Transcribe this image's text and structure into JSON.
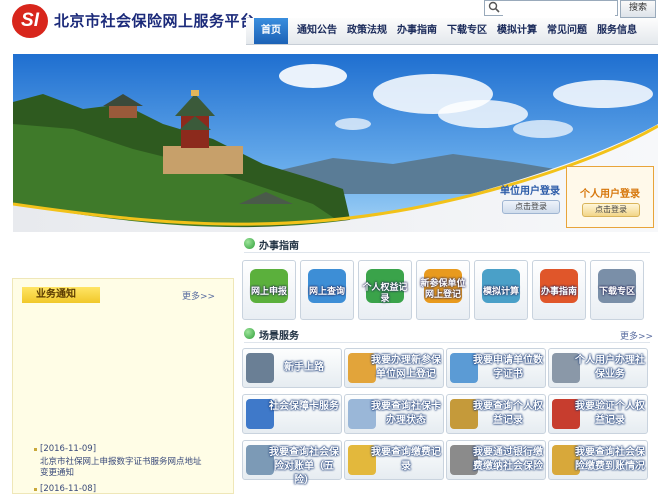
{
  "header": {
    "logo_text": "SI",
    "title": "北京市社会保险网上服务平台",
    "search": {
      "placeholder": "",
      "button_label": "搜索"
    }
  },
  "nav": {
    "items": [
      {
        "label": "首页",
        "active": true
      },
      {
        "label": "通知公告"
      },
      {
        "label": "政策法规"
      },
      {
        "label": "办事指南"
      },
      {
        "label": "下载专区"
      },
      {
        "label": "模拟计算"
      },
      {
        "label": "常见问题"
      },
      {
        "label": "服务信息"
      }
    ]
  },
  "login": {
    "unit": {
      "title": "单位用户登录",
      "button": "点击登录"
    },
    "personal": {
      "title": "个人用户登录",
      "button": "点击登录"
    }
  },
  "notices": {
    "tab_label": "业务通知",
    "more": "更多>>",
    "items": [
      {
        "date": "[2016-11-09]",
        "text_line1": "北京市社保网上申报数字证书服务网点地址",
        "text_line2": "变更通知"
      },
      {
        "date": "[2016-11-08]",
        "text_line1": "",
        "text_line2": ""
      }
    ]
  },
  "guide": {
    "title": "办事指南",
    "items": [
      {
        "label": "网上申报",
        "color": "#5bb03c"
      },
      {
        "label": "网上查询",
        "color": "#3d8ed6"
      },
      {
        "label": "个人权益记录",
        "color": "#3aa34a"
      },
      {
        "label": "新参保单位网上登记",
        "color": "#e89a1e"
      },
      {
        "label": "模拟计算",
        "color": "#4aa0c8"
      },
      {
        "label": "办事指南",
        "color": "#e0562a"
      },
      {
        "label": "下载专区",
        "color": "#7a8fa8"
      }
    ]
  },
  "scenes": {
    "title": "场景服务",
    "more": "更多>>",
    "items": [
      {
        "label": "新手上路",
        "color": "#6a7f95"
      },
      {
        "label": "我要办理新参保单位网上登记",
        "color": "#e2a43a"
      },
      {
        "label": "我要申请单位数字证书",
        "color": "#5b9bd5"
      },
      {
        "label": "个人用户办理社保业务",
        "color": "#8a98a8"
      },
      {
        "label": "社会保障卡服务",
        "color": "#3f79c9"
      },
      {
        "label": "我要查询社保卡办理状态",
        "color": "#9ab7d8"
      },
      {
        "label": "我要查询个人权益记录",
        "color": "#c59a3a"
      },
      {
        "label": "我要验证个人权益记录",
        "color": "#c73d2e"
      },
      {
        "label": "我要查询社会保险对账单（五险）",
        "color": "#7c9ab6"
      },
      {
        "label": "我要查询缴费记录",
        "color": "#e3b83c"
      },
      {
        "label": "我要通过银行缴费缴纳社会保险",
        "color": "#8b8b8b"
      },
      {
        "label": "我要查询社会保险缴费到账情况",
        "color": "#d8a83a"
      }
    ]
  },
  "colors": {
    "brand_red": "#d8261c",
    "nav_active": "#2a78cc",
    "title_blue": "#1b2a7a"
  }
}
